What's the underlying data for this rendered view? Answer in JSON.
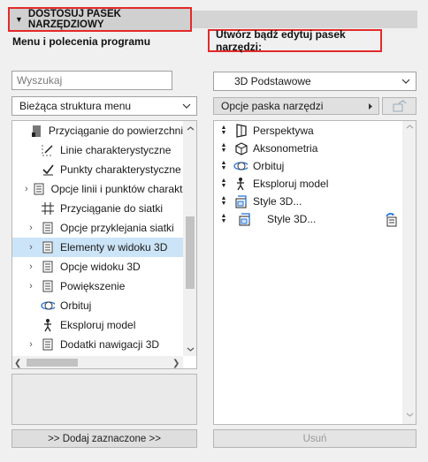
{
  "header": {
    "title": "DOSTOSUJ PASEK NARZĘDZIOWY"
  },
  "left": {
    "label": "Menu i polecenia programu",
    "search_placeholder": "Wyszukaj",
    "structure_select": "Bieżąca struktura menu",
    "items": [
      {
        "label": "Przyciąganie do powierzchni",
        "icon": "surface-snap-icon",
        "expandable": false,
        "selected": false
      },
      {
        "label": "Linie charakterystyczne",
        "icon": "feature-lines-icon",
        "expandable": false,
        "selected": false
      },
      {
        "label": "Punkty charakterystyczne",
        "icon": "feature-points-icon",
        "expandable": false,
        "selected": false
      },
      {
        "label": "Opcje linii i punktów charakterystycznych",
        "icon": "menu-page-icon",
        "expandable": true,
        "selected": false
      },
      {
        "label": "Przyciąganie do siatki",
        "icon": "grid-snap-icon",
        "expandable": false,
        "selected": false
      },
      {
        "label": "Opcje przyklejania siatki",
        "icon": "menu-page-icon",
        "expandable": true,
        "selected": false
      },
      {
        "label": "Elementy w widoku 3D",
        "icon": "menu-page-icon",
        "expandable": true,
        "selected": true
      },
      {
        "label": "Opcje widoku 3D",
        "icon": "menu-page-icon",
        "expandable": true,
        "selected": false
      },
      {
        "label": "Powiększenie",
        "icon": "menu-page-icon",
        "expandable": true,
        "selected": false
      },
      {
        "label": "Orbituj",
        "icon": "orbit-icon",
        "expandable": false,
        "selected": false
      },
      {
        "label": "Eksploruj model",
        "icon": "explore-icon",
        "expandable": false,
        "selected": false
      },
      {
        "label": "Dodatki nawigacji 3D",
        "icon": "menu-page-icon",
        "expandable": true,
        "selected": false
      }
    ],
    "add_button": ">> Dodaj zaznaczone >>"
  },
  "right": {
    "label": "Utwórz bądź edytuj pasek narzędzi:",
    "toolbar_select": "3D Podstawowe",
    "options_select": "Opcje paska narzędzi",
    "items": [
      {
        "label": "Perspektywa",
        "icon": "perspective-icon",
        "indent": 0
      },
      {
        "label": "Aksonometria",
        "icon": "axonometry-icon",
        "indent": 0
      },
      {
        "label": "Orbituj",
        "icon": "orbit-icon",
        "indent": 0
      },
      {
        "label": "Eksploruj model",
        "icon": "explore-icon",
        "indent": 0
      },
      {
        "label": "Style 3D...",
        "icon": "style-3d-icon",
        "indent": 0
      },
      {
        "label": "Style 3D...",
        "icon": "style-3d-icon",
        "indent": 1
      }
    ],
    "remove_button": "Usuń"
  },
  "colors": {
    "highlight": "#e32a2a",
    "selection": "#cce4f7"
  }
}
